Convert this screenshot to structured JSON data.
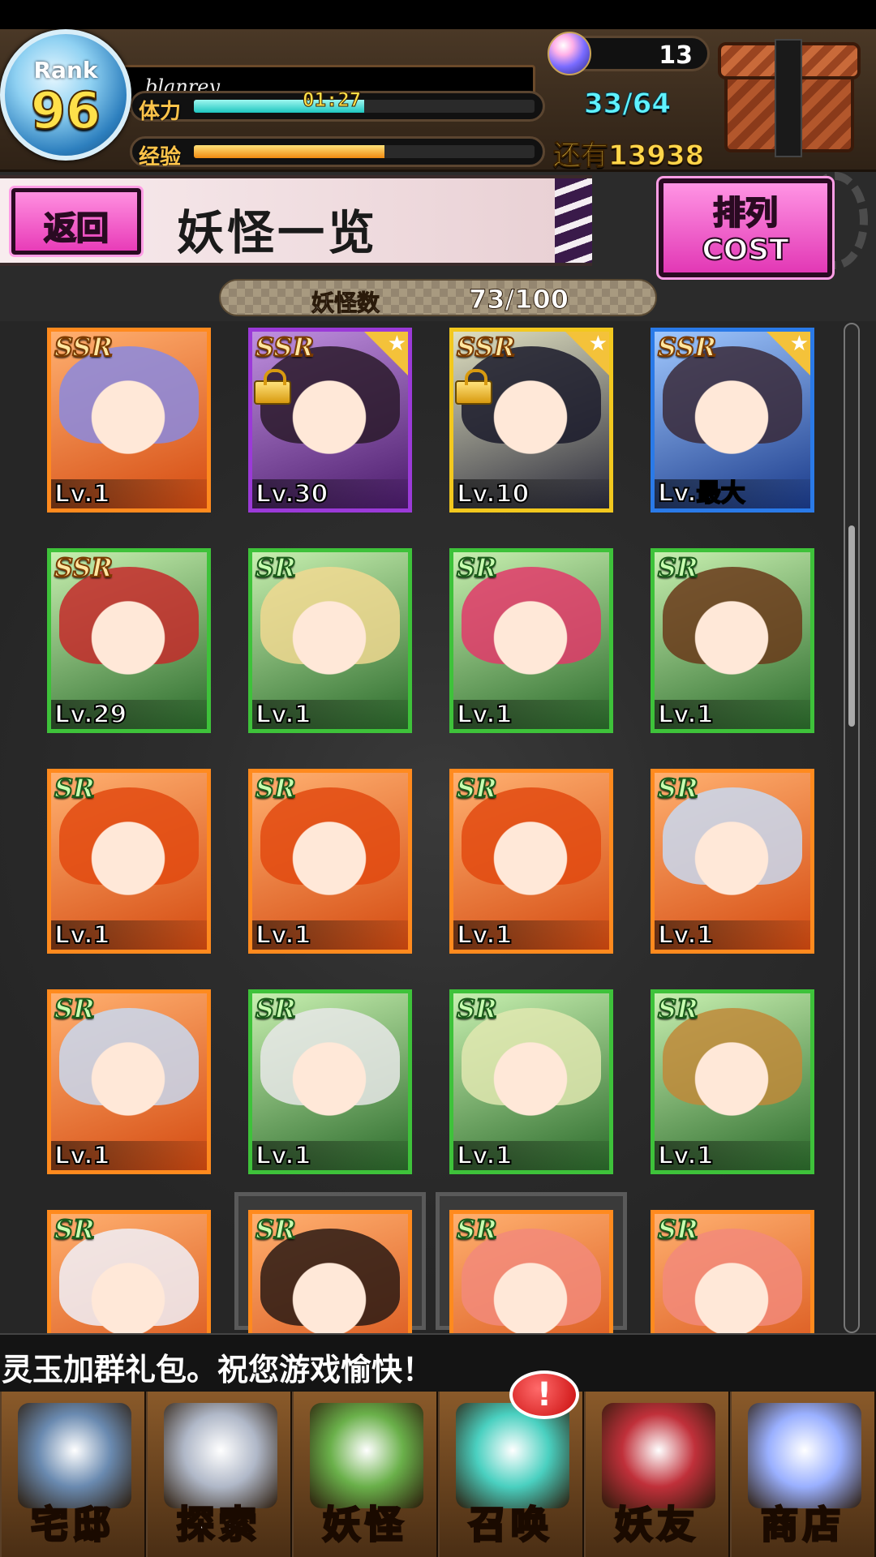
{
  "header": {
    "rank_label": "Rank",
    "rank_value": "96",
    "player_name": "blanrey",
    "stamina_label": "体力",
    "stamina_timer": "01:27",
    "stamina_count": "33/64",
    "stamina_fraction": 0.5,
    "exp_label": "经验",
    "exp_remaining": "还有13938",
    "exp_fraction": 0.56,
    "orb_count": "13",
    "orb_icon": "spirit-orb-icon",
    "chest_icon": "treasure-chest-icon"
  },
  "title_bar": {
    "back_label": "返回",
    "title": "妖怪一览",
    "sort_label": "排列",
    "sort_value": "COST"
  },
  "count_bar": {
    "label": "妖怪数",
    "value": "73/100"
  },
  "scroll": {
    "position_fraction": 0.2,
    "visible_fraction": 0.2
  },
  "cards": [
    {
      "rarity": "SSR",
      "level": "Lv.1",
      "frame": "orange",
      "hair": "#8a8ae0",
      "star": false,
      "locked": false
    },
    {
      "rarity": "SSR",
      "level": "Lv.30",
      "frame": "purple",
      "hair": "#2a1a2a",
      "star": true,
      "locked": true
    },
    {
      "rarity": "SSR",
      "level": "Lv.10",
      "frame": "gold",
      "hair": "#1a1a2a",
      "star": true,
      "locked": true
    },
    {
      "rarity": "SSR",
      "level": "Lv.最大",
      "frame": "blue",
      "hair": "#3a2a3a",
      "star": true,
      "locked": false
    },
    {
      "rarity": "SSR",
      "level": "Lv.29",
      "frame": "green",
      "hair": "#c42a2a",
      "star": false,
      "locked": false
    },
    {
      "rarity": "SR",
      "level": "Lv.1",
      "frame": "green",
      "hair": "#f0d890",
      "star": false,
      "locked": false
    },
    {
      "rarity": "SR",
      "level": "Lv.1",
      "frame": "green",
      "hair": "#e23a6a",
      "star": false,
      "locked": false
    },
    {
      "rarity": "SR",
      "level": "Lv.1",
      "frame": "green",
      "hair": "#6a3a1a",
      "star": false,
      "locked": false
    },
    {
      "rarity": "SR",
      "level": "Lv.1",
      "frame": "orange",
      "hair": "#e24a10",
      "star": false,
      "locked": false
    },
    {
      "rarity": "SR",
      "level": "Lv.1",
      "frame": "orange",
      "hair": "#e24a10",
      "star": false,
      "locked": false
    },
    {
      "rarity": "SR",
      "level": "Lv.1",
      "frame": "orange",
      "hair": "#e24a10",
      "star": false,
      "locked": false
    },
    {
      "rarity": "SR",
      "level": "Lv.1",
      "frame": "orange",
      "hair": "#c8d8f0",
      "star": false,
      "locked": false
    },
    {
      "rarity": "SR",
      "level": "Lv.1",
      "frame": "orange",
      "hair": "#c8d8f0",
      "star": false,
      "locked": false
    },
    {
      "rarity": "SR",
      "level": "Lv.1",
      "frame": "green",
      "hair": "#e8e8e8",
      "star": false,
      "locked": false
    },
    {
      "rarity": "SR",
      "level": "Lv.1",
      "frame": "green",
      "hair": "#e0e8b0",
      "star": false,
      "locked": false
    },
    {
      "rarity": "SR",
      "level": "Lv.1",
      "frame": "green",
      "hair": "#c08a3a",
      "star": false,
      "locked": false
    },
    {
      "rarity": "SR",
      "level": "",
      "frame": "orange",
      "hair": "#f0f0f8",
      "star": false,
      "locked": false
    },
    {
      "rarity": "SR",
      "level": "",
      "frame": "orange",
      "hair": "#2a1a14",
      "star": false,
      "locked": false
    },
    {
      "rarity": "SR",
      "level": "",
      "frame": "orange",
      "hair": "#f28a7a",
      "star": false,
      "locked": false
    },
    {
      "rarity": "SR",
      "level": "",
      "frame": "orange",
      "hair": "#f28a7a",
      "star": false,
      "locked": false
    }
  ],
  "marquee": "灵玉加群礼包。祝您游戏愉快！",
  "nav": [
    {
      "label": "宅邸",
      "icon": "mansion-icon",
      "art": "#6a8ab0"
    },
    {
      "label": "探索",
      "icon": "magnifier-map-icon",
      "art": "#b0b8c8"
    },
    {
      "label": "妖怪",
      "icon": "scroll-icon",
      "art": "#6ab04a"
    },
    {
      "label": "召唤",
      "icon": "pentagram-icon",
      "art": "#4ad0c0"
    },
    {
      "label": "妖友",
      "icon": "friend-girl-icon",
      "art": "#c0303a"
    },
    {
      "label": "商店",
      "icon": "crystal-orb-icon",
      "art": "#9ab0ff"
    }
  ],
  "nav_alert": "!"
}
